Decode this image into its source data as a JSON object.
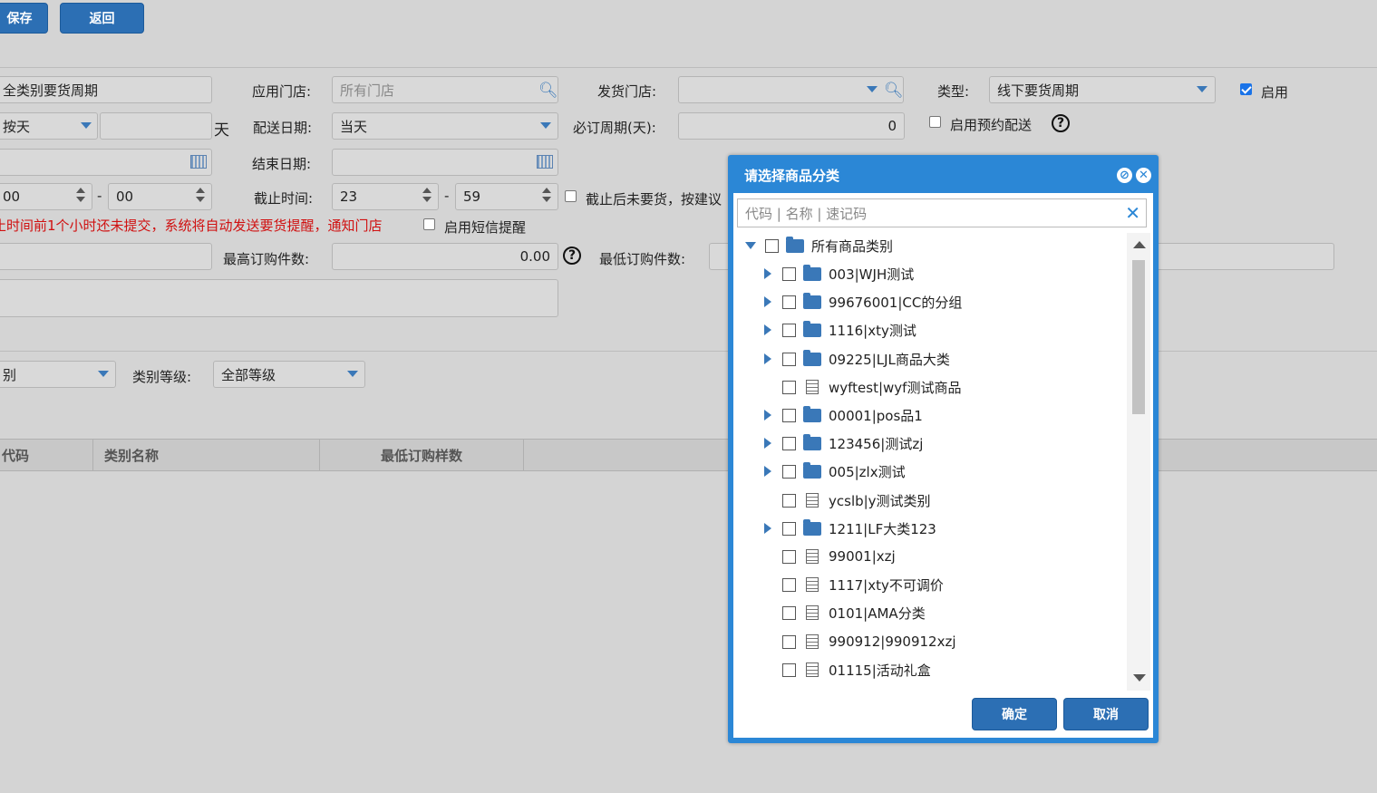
{
  "toolbar": {
    "save_label": "保存",
    "back_label": "返回"
  },
  "form": {
    "name_value": "全类别要货周期",
    "apply_store_label": "应用门店:",
    "apply_store_placeholder": "所有门店",
    "ship_store_label": "发货门店:",
    "ship_store_value": "",
    "type_label": "类型:",
    "type_value": "线下要货周期",
    "enable_label": "启用",
    "enable_checked": true,
    "period_unit_value": "按天",
    "period_num_value": "",
    "day_suffix": "天",
    "delivery_date_label": "配送日期:",
    "delivery_date_value": "当天",
    "required_cycle_label": "必订周期(天):",
    "required_cycle_value": "0",
    "reserve_delivery_label": "启用预约配送",
    "end_date_label": "结束日期:",
    "start_hour_value": "00",
    "start_min_value": "00",
    "cutoff_label": "截止时间:",
    "cutoff_hour_value": "23",
    "cutoff_min_value": "59",
    "cutoff_after_label": "截止后未要货，按建议",
    "reminder_text": "止时间前1个小时还未提交，系统将自动发送要货提醒，通知门店",
    "sms_label": "启用短信提醒",
    "max_qty_label": "最高订购件数:",
    "max_qty_value": "0.00",
    "min_qty_label": "最低订购件数:",
    "time_sep": "-",
    "help_glyph": "?"
  },
  "filter": {
    "category_value": "别",
    "level_label": "类别等级:",
    "level_value": "全部等级"
  },
  "table": {
    "headers": [
      "代码",
      "类别名称",
      "最低订购样数"
    ]
  },
  "dialog": {
    "title": "请选择商品分类",
    "search_placeholder": "代码 | 名称 | 速记码",
    "clear_glyph": "✕",
    "ok_label": "确定",
    "cancel_label": "取消",
    "root_label": "所有商品类别",
    "items": [
      {
        "label": "003|WJH测试",
        "type": "folder"
      },
      {
        "label": "99676001|CC的分组",
        "type": "folder"
      },
      {
        "label": "1116|xty测试",
        "type": "folder"
      },
      {
        "label": "09225|LJL商品大类",
        "type": "folder"
      },
      {
        "label": "wyftest|wyf测试商品",
        "type": "leaf"
      },
      {
        "label": "00001|pos品1",
        "type": "folder"
      },
      {
        "label": "123456|测试zj",
        "type": "folder"
      },
      {
        "label": "005|zlx测试",
        "type": "folder"
      },
      {
        "label": "ycslb|y测试类别",
        "type": "leaf"
      },
      {
        "label": "1211|LF大类123",
        "type": "folder"
      },
      {
        "label": "99001|xzj",
        "type": "leaf"
      },
      {
        "label": "1117|xty不可调价",
        "type": "leaf"
      },
      {
        "label": "0101|AMA分类",
        "type": "leaf"
      },
      {
        "label": "990912|990912xzj",
        "type": "leaf"
      },
      {
        "label": "01115|活动礼盒",
        "type": "leaf"
      }
    ]
  },
  "colors": {
    "accent": "#2b87d6",
    "button": "#2c6fb4",
    "warning": "#d01010"
  }
}
